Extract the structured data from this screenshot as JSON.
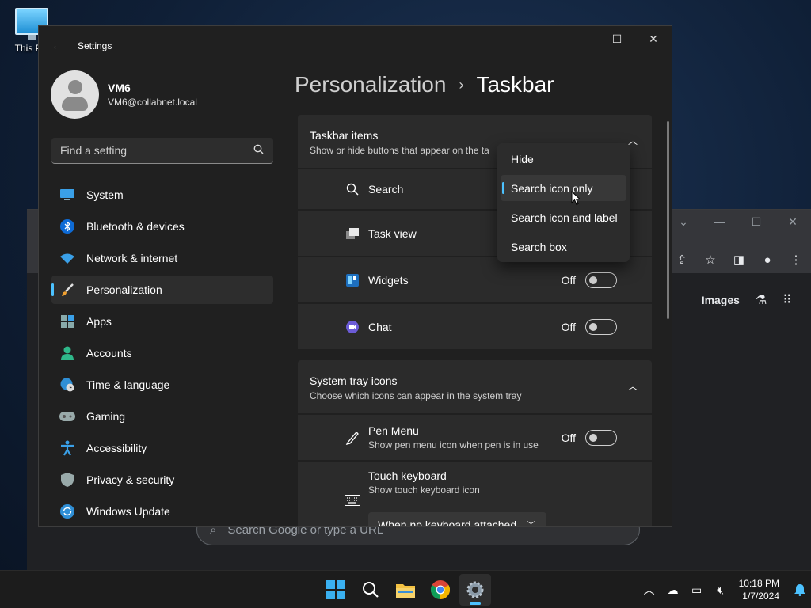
{
  "desktop": {
    "icon_label": "This PC"
  },
  "browser": {
    "images_link": "Images",
    "search_placeholder": "Search Google or type a URL"
  },
  "settings": {
    "title": "Settings",
    "profile": {
      "name": "VM6",
      "email": "VM6@collabnet.local"
    },
    "search_placeholder": "Find a setting",
    "nav": [
      {
        "label": "System",
        "icon": "monitor-icon"
      },
      {
        "label": "Bluetooth & devices",
        "icon": "bluetooth-icon"
      },
      {
        "label": "Network & internet",
        "icon": "wifi-icon"
      },
      {
        "label": "Personalization",
        "icon": "paintbrush-icon"
      },
      {
        "label": "Apps",
        "icon": "apps-icon"
      },
      {
        "label": "Accounts",
        "icon": "person-icon"
      },
      {
        "label": "Time & language",
        "icon": "globe-clock-icon"
      },
      {
        "label": "Gaming",
        "icon": "gamepad-icon"
      },
      {
        "label": "Accessibility",
        "icon": "accessibility-icon"
      },
      {
        "label": "Privacy & security",
        "icon": "shield-icon"
      },
      {
        "label": "Windows Update",
        "icon": "update-icon"
      }
    ],
    "active_nav": "Personalization",
    "breadcrumb": {
      "parent": "Personalization",
      "separator": "›",
      "current": "Taskbar"
    },
    "taskbar_items": {
      "title": "Taskbar items",
      "subtitle": "Show or hide buttons that appear on the ta",
      "rows": [
        {
          "label": "Search"
        },
        {
          "label": "Task view"
        },
        {
          "label": "Widgets",
          "state": "Off"
        },
        {
          "label": "Chat",
          "state": "Off"
        }
      ]
    },
    "system_tray": {
      "title": "System tray icons",
      "subtitle": "Choose which icons can appear in the system tray",
      "pen": {
        "label": "Pen Menu",
        "sub": "Show pen menu icon when pen is in use",
        "state": "Off"
      },
      "touch": {
        "label": "Touch keyboard",
        "sub": "Show touch keyboard icon",
        "select": "When no keyboard attached"
      }
    },
    "dropdown": {
      "options": [
        "Hide",
        "Search icon only",
        "Search icon and label",
        "Search box"
      ],
      "selected": "Search icon only"
    }
  },
  "taskbar": {
    "time": "10:18 PM",
    "date": "1/7/2024"
  },
  "colors": {
    "accent": "#4cc2ff",
    "window_bg": "#202020",
    "card_bg": "#2b2b2b"
  }
}
